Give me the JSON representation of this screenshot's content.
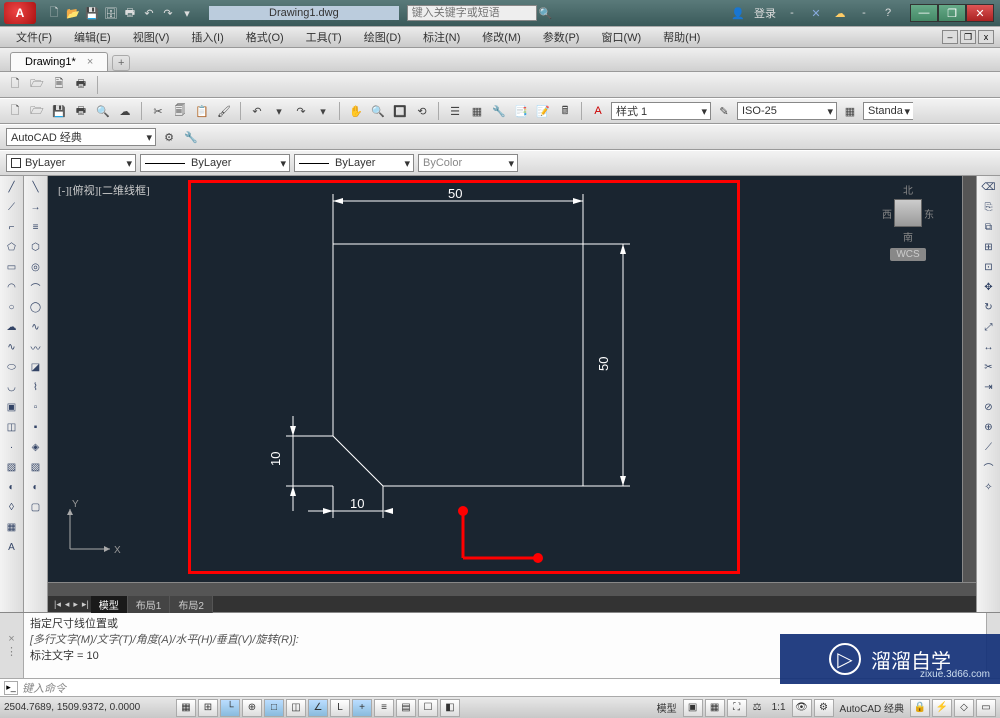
{
  "title": {
    "doc": "Drawing1.dwg",
    "search_placeholder": "键入关键字或短语",
    "login": "登录"
  },
  "menus": [
    "文件(F)",
    "编辑(E)",
    "视图(V)",
    "插入(I)",
    "格式(O)",
    "工具(T)",
    "绘图(D)",
    "标注(N)",
    "修改(M)",
    "参数(P)",
    "窗口(W)",
    "帮助(H)"
  ],
  "tab": {
    "name": "Drawing1*"
  },
  "combo": {
    "workspace": "AutoCAD 经典",
    "layer": "ByLayer",
    "linetype": "ByLayer",
    "lineweight": "ByLayer",
    "color": "ByColor",
    "textstyle": "样式 1",
    "dimstyle": "ISO-25",
    "tablestyle": "Standa"
  },
  "viewport": {
    "label": "[-][俯视][二维线框]"
  },
  "viewcube": {
    "n": "北",
    "s": "南",
    "e": "东",
    "w": "西",
    "wcs": "WCS"
  },
  "ucs": {
    "x": "X",
    "y": "Y"
  },
  "modeltabs": {
    "model": "模型",
    "layout1": "布局1",
    "layout2": "布局2"
  },
  "cmd": {
    "line1": "指定尺寸线位置或",
    "line2": "[多行文字(M)/文字(T)/角度(A)/水平(H)/垂直(V)/旋转(R)]:",
    "line3": "标注文字 = 10",
    "prompt": "键入命令"
  },
  "status": {
    "coords": "2504.7689, 1509.9372, 0.0000",
    "model": "模型",
    "scale": "1:1",
    "ws": "AutoCAD 经典"
  },
  "dims": {
    "top": "50",
    "right": "50",
    "left": "10",
    "bottom": "10"
  },
  "watermark": {
    "text": "溜溜自学",
    "url": "zixue.3d66.com"
  }
}
